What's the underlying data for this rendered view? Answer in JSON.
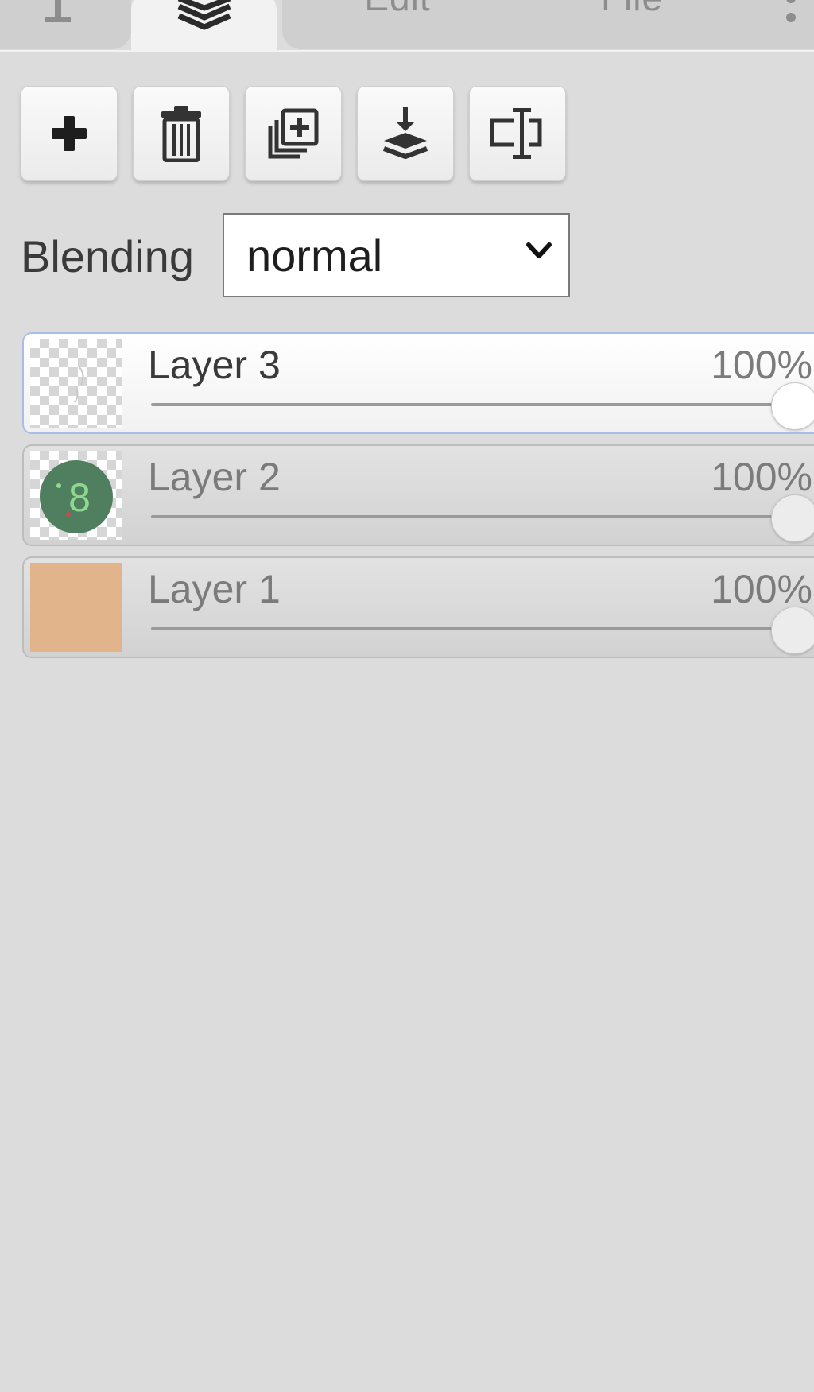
{
  "tabs": {
    "edit_label": "Edit",
    "file_label": "File"
  },
  "toolbar": {
    "buttons": [
      {
        "icon": "plus-icon"
      },
      {
        "icon": "trash-icon"
      },
      {
        "icon": "duplicate-icon"
      },
      {
        "icon": "merge-down-icon"
      },
      {
        "icon": "rename-icon"
      }
    ]
  },
  "blending": {
    "label": "Blending",
    "selected": "normal"
  },
  "layers": [
    {
      "name": "Layer 3",
      "opacity": "100%",
      "opacity_value": 1.0,
      "active": true,
      "thumb": "transparent"
    },
    {
      "name": "Layer 2",
      "opacity": "100%",
      "opacity_value": 1.0,
      "active": false,
      "thumb": "green-circle"
    },
    {
      "name": "Layer 1",
      "opacity": "100%",
      "opacity_value": 1.0,
      "active": false,
      "thumb": "solid",
      "thumb_color": "#e2b48c"
    }
  ],
  "colors": {
    "active_border": "#a9bde6",
    "layer1_fill": "#e2b48c",
    "layer2_circle": "#4f7f5e"
  }
}
